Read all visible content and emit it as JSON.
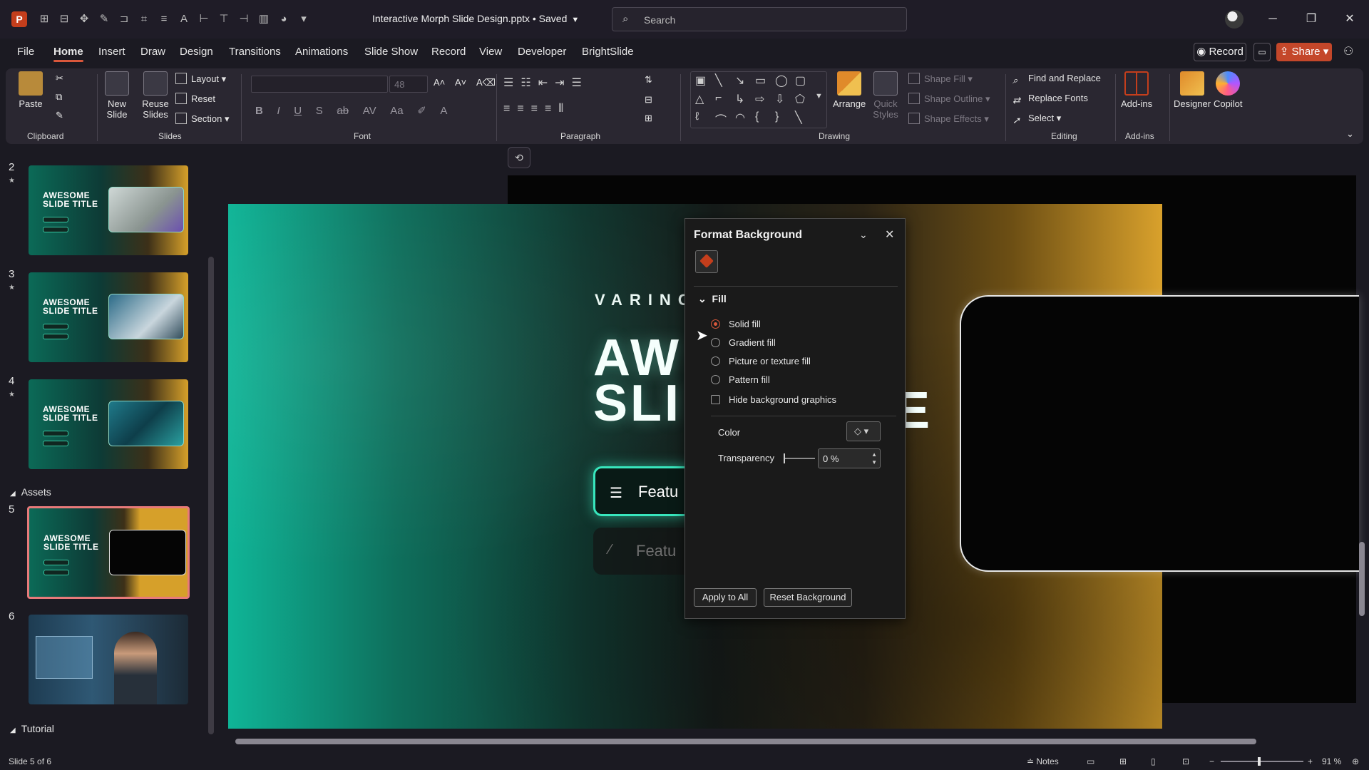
{
  "titlebar": {
    "app_icon": "P",
    "qat_icons": [
      "pin-icon",
      "layout-icon",
      "morph-icon",
      "magic-icon",
      "align-icon",
      "crop-icon",
      "lines-icon",
      "text-icon",
      "distribute-icon",
      "distribute-v-icon",
      "align-right-icon",
      "chart-icon",
      "shapes-icon",
      "more-icon"
    ],
    "doc_title": "Interactive Morph Slide Design.pptx • Saved",
    "search_placeholder": "Search"
  },
  "tabs": [
    "File",
    "Home",
    "Insert",
    "Draw",
    "Design",
    "Transitions",
    "Animations",
    "Slide Show",
    "Record",
    "View",
    "Developer",
    "BrightSlide"
  ],
  "active_tab": "Home",
  "top_actions": {
    "record": "Record",
    "share": "Share"
  },
  "ribbon": {
    "clipboard": {
      "paste": "Paste",
      "group": "Clipboard"
    },
    "slides": {
      "new_slide": "New Slide",
      "reuse_slides": "Reuse Slides",
      "layout": "Layout",
      "reset": "Reset",
      "section": "Section",
      "group": "Slides"
    },
    "font": {
      "size": "48",
      "group": "Font",
      "format_buttons": [
        "B",
        "I",
        "U",
        "S",
        "ab",
        "AV",
        "Aa"
      ]
    },
    "paragraph": {
      "group": "Paragraph"
    },
    "drawing": {
      "arrange": "Arrange",
      "quick_styles": "Quick Styles",
      "shape_fill": "Shape Fill",
      "shape_outline": "Shape Outline",
      "shape_effects": "Shape Effects",
      "group": "Drawing"
    },
    "editing": {
      "find_replace": "Find and Replace",
      "replace_fonts": "Replace Fonts",
      "select": "Select",
      "group": "Editing"
    },
    "addins": {
      "addins": "Add-ins",
      "group": "Add-ins"
    },
    "designer": "Designer",
    "copilot": "Copilot"
  },
  "slides_panel": {
    "thumbs": [
      {
        "num": "2",
        "title": "AWESOME SLIDE TITLE"
      },
      {
        "num": "3",
        "title": "AWESOME SLIDE TITLE"
      },
      {
        "num": "4",
        "title": "AWESOME SLIDE TITLE"
      },
      {
        "num": "5",
        "title": "AWESOME SLIDE TITLE"
      },
      {
        "num": "6",
        "title": ""
      }
    ],
    "section_assets": "Assets",
    "section_tutorial": "Tutorial"
  },
  "slide": {
    "brand": "VARINC",
    "title_line1": "AW",
    "title_line2": "SLI",
    "title_end": "E",
    "feature1": "Featu",
    "feature2": "Featu"
  },
  "format_background": {
    "title": "Format Background",
    "fill_section": "Fill",
    "options": [
      "Solid fill",
      "Gradient fill",
      "Picture or texture fill",
      "Pattern fill"
    ],
    "selected_option": "Solid fill",
    "hide_graphics": "Hide background graphics",
    "color_label": "Color",
    "transparency_label": "Transparency",
    "transparency_value": "0 %",
    "apply_all": "Apply to All",
    "reset_background": "Reset Background"
  },
  "status": {
    "slide_info": "Slide 5 of 6",
    "notes": "Notes",
    "zoom": "91 %"
  },
  "colors": {
    "accent": "#d9573b",
    "teal": "#38e6bd",
    "gold": "#d9a12c"
  }
}
